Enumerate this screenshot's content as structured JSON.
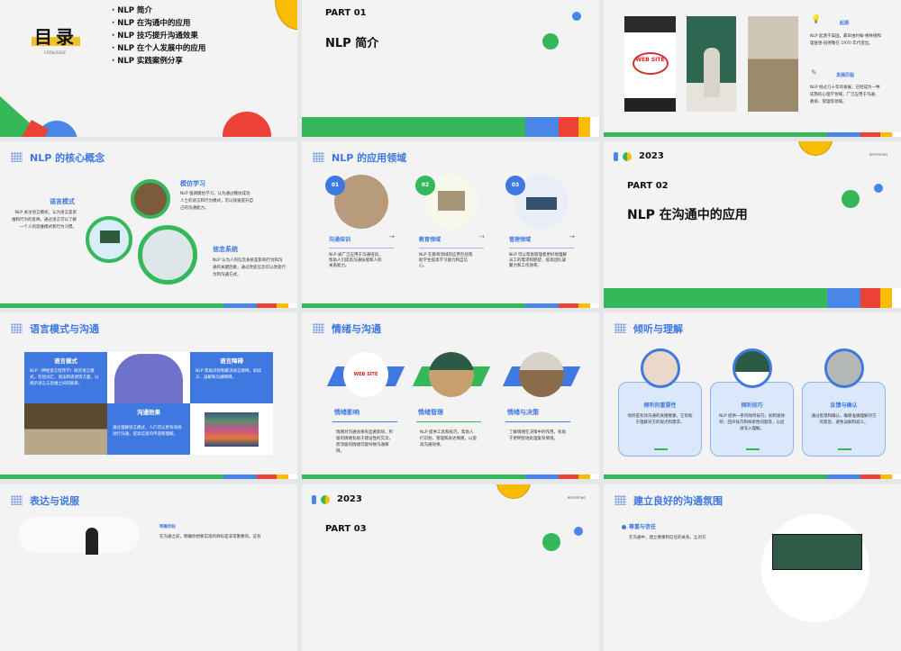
{
  "slides": {
    "toc": {
      "title": "目录",
      "subtitle": "CATALOGUE",
      "items": [
        "NLP 简介",
        "NLP 在沟通中的应用",
        "NLP 技巧提升沟通效果",
        "NLP 在个人发展中的应用",
        "NLP 实践案例分享"
      ]
    },
    "part1": {
      "part": "PART 01",
      "title": "NLP 简介"
    },
    "origin": {
      "image_text": "WEB SITE",
      "items": [
        {
          "title": "起源",
          "text": "NLP 起源于美国，最早由约翰·格林德和理查德·班德勒在 1970 年代提出。"
        },
        {
          "title": "发展历程",
          "text": "NLP 经过几十年的发展，已经成为一种成熟的心理学领域，广泛应用于沟通、教育、管理等领域。"
        }
      ]
    },
    "core": {
      "title": "NLP 的核心概念",
      "items": [
        {
          "title": "语言模式",
          "text": "NLP 关注语言模式，认为语言是思维和行为的反映，通过语言可以了解一个人的思维模式和行为习惯。"
        },
        {
          "title": "模仿学习",
          "text": "NLP 强调模仿学习，认为通过模仿成功人士的语言和行为模式，可以快速提升自己的沟通能力。"
        },
        {
          "title": "信念系统",
          "text": "NLP 认为人的信念系统是影响行为和沟通的关键因素，通过改变信念可以改变行为和沟通方式。"
        }
      ]
    },
    "fields": {
      "title": "NLP 的应用领域",
      "arrow": "→",
      "items": [
        {
          "num": "01",
          "title": "沟通培训",
          "text": "NLP 被广泛应用于沟通培训，帮助人们提高沟通技能和人际关系能力。",
          "color": "#3f78e0"
        },
        {
          "num": "02",
          "title": "教育领域",
          "text": "NLP 在教育领域的应用包括帮助学生提高学习能力和自信心。",
          "color": "#34b85a"
        },
        {
          "num": "03",
          "title": "管理领域",
          "text": "NLP 可以帮助管理者更好地理解员工的需求和期望，提高团队凝聚力和工作效率。",
          "color": "#3f78e0"
        }
      ]
    },
    "part2": {
      "year": "2023",
      "tag": "REPORTING",
      "part": "PART 02",
      "title": "NLP 在沟通中的应用"
    },
    "language": {
      "title": "语言模式与沟通",
      "cells": [
        {
          "title": "语言模式",
          "text": "NLP（神经语言程序学）研究语言模式，包括词汇、语法和语调等方面，以揭示语言与思维之间的联系。"
        },
        {
          "title": "语言障碍",
          "text": "NLP 帮助识别和解决语言障碍，如歧义、误解和沟通障碍。"
        },
        {
          "title": "沟通效果",
          "text": "通过理解语言模式，人们可以更有效地进行沟通，提高信息的传递和理解。"
        }
      ]
    },
    "emotion": {
      "title": "情绪与沟通",
      "image_text": "WEB SITE",
      "items": [
        {
          "title": "情绪影响",
          "text": "情绪对沟通效果有显著影响，积极的情绪有助于建设性的交流，而消极的情绪可能导致沟通障碍。"
        },
        {
          "title": "情绪管理",
          "text": "NLP 提供工具和技巧，帮助人们识别、管理和表达情绪，以提高沟通效果。"
        },
        {
          "title": "情绪与决策",
          "text": "了解情绪在决策中的作用，有助于更明智地处理复杂情境。"
        }
      ]
    },
    "listen": {
      "title": "倾听与理解",
      "items": [
        {
          "title": "倾听的重要性",
          "text": "倾听是有效沟通的关键要素，它有助于理解对方的观点和需求。"
        },
        {
          "title": "倾听技巧",
          "text": "NLP 提供一系列倾听技巧，如积极倾听、回声技巧和探索性问题等，以促进深入理解。"
        },
        {
          "title": "反馈与确认",
          "text": "通过反馈和确认，确保准确理解对方的意思，避免误解和歧义。"
        }
      ]
    },
    "express": {
      "title": "表达与说服",
      "item_title": "明确目标",
      "item_text": "在沟通之前，明确你想要实现的目标是非常重要的。这有"
    },
    "part3": {
      "year": "2023",
      "tag": "REPORTING",
      "part": "PART 03"
    },
    "atmosphere": {
      "title": "建立良好的沟通氛围",
      "item_title": "尊重与信任",
      "item_text": "在沟通中，建立尊重和信任的关系，让对方"
    }
  },
  "colors": {
    "blue": "#3f78e0",
    "green": "#34b85a",
    "red": "#ea4335",
    "yellow": "#fbbc04"
  }
}
